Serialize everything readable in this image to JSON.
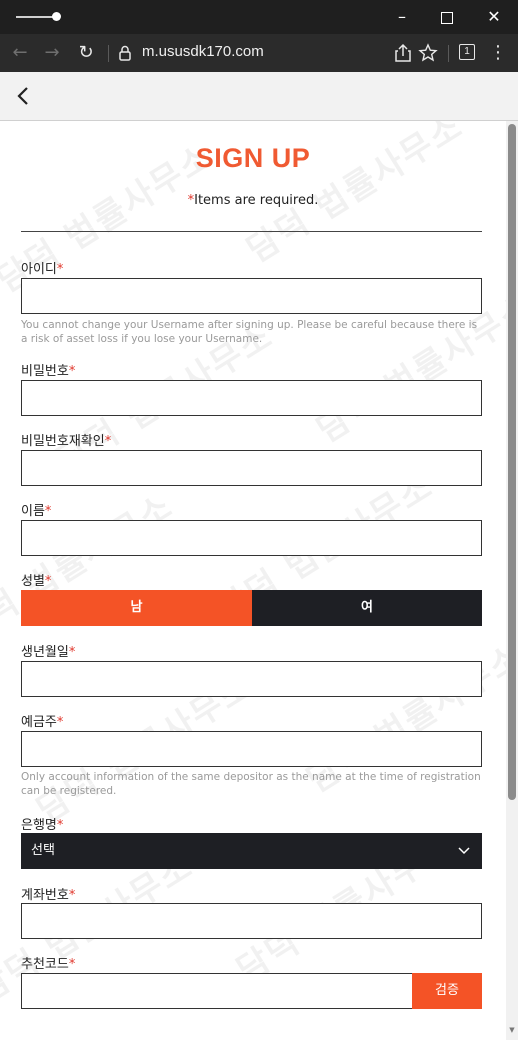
{
  "browser": {
    "url": "m.ususdk170.com",
    "tab_count": "1"
  },
  "page": {
    "title": "SIGN UP",
    "required_star": "*",
    "required_note": "Items are required.",
    "watermark": "담덕 법률사무소"
  },
  "fields": {
    "username": {
      "label": "아이디",
      "help": "You cannot change your Username after signing up. Please be careful because there is a risk of asset loss if you lose your Username."
    },
    "password": {
      "label": "비밀번호"
    },
    "password_confirm": {
      "label": "비밀번호재확인"
    },
    "name": {
      "label": "이름"
    },
    "gender": {
      "label": "성별",
      "options": [
        "남",
        "여"
      ],
      "selected": "남"
    },
    "birthdate": {
      "label": "생년월일"
    },
    "depositor": {
      "label": "예금주",
      "help": "Only account information of the same depositor as the name at the time of registration can be registered."
    },
    "bank": {
      "label": "은행명",
      "value": "선택"
    },
    "account_number": {
      "label": "계좌번호"
    },
    "referral": {
      "label": "추천코드",
      "verify_label": "검증"
    }
  },
  "colors": {
    "accent": "#f45326",
    "title": "#f05a32",
    "dark": "#1e1f24",
    "required": "#e0372c"
  }
}
